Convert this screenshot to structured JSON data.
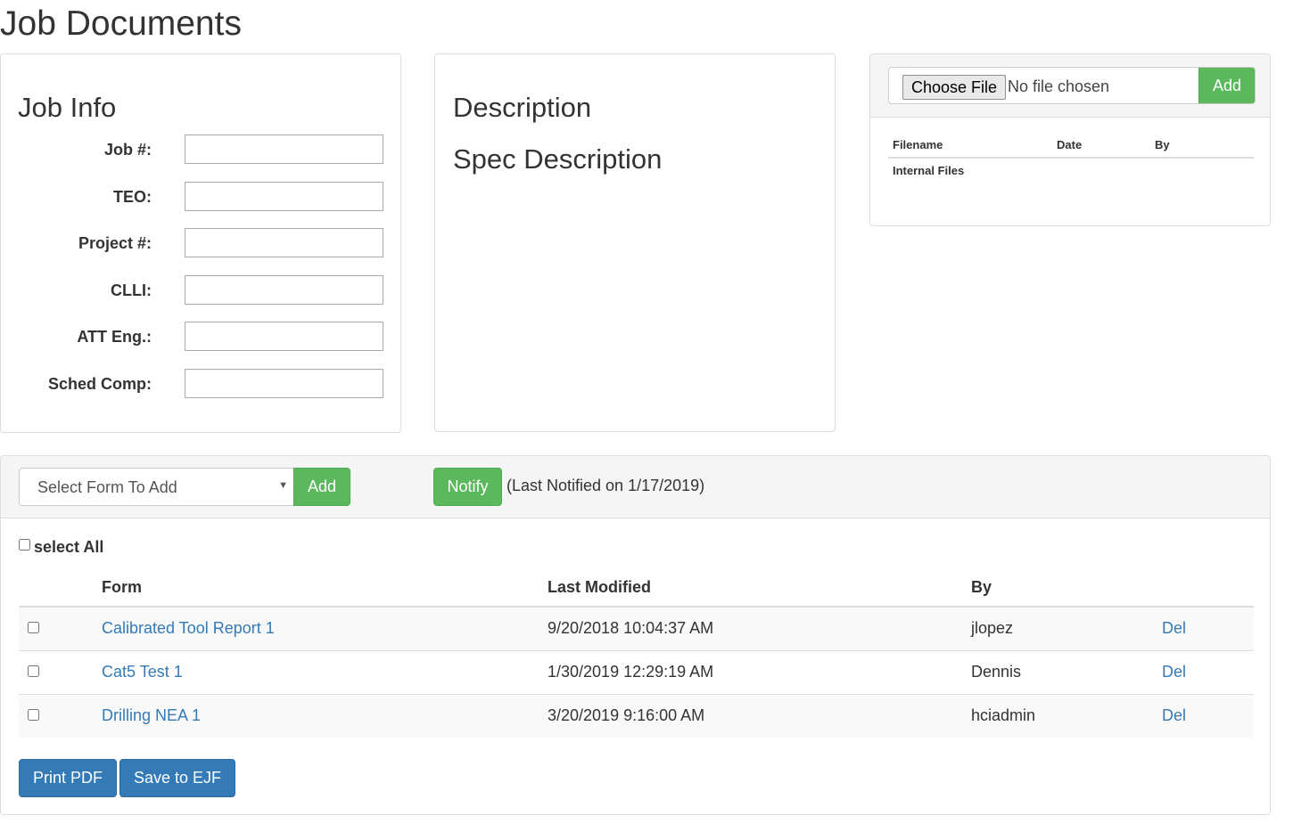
{
  "page": {
    "title": "Job Documents"
  },
  "job_info": {
    "heading": "Job Info",
    "fields": [
      {
        "label": "Job #:",
        "value": ""
      },
      {
        "label": "TEO:",
        "value": ""
      },
      {
        "label": "Project #:",
        "value": ""
      },
      {
        "label": "CLLI:",
        "value": ""
      },
      {
        "label": "ATT Eng.:",
        "value": ""
      },
      {
        "label": "Sched Comp:",
        "value": ""
      }
    ]
  },
  "description": {
    "heading": "Description",
    "spec_heading": "Spec Description"
  },
  "files": {
    "choose_file_label": "Choose File",
    "no_file_text": "No file chosen",
    "add_label": "Add",
    "columns": [
      "Filename",
      "Date",
      "By"
    ],
    "rows": [
      {
        "filename": "Internal Files",
        "date": "",
        "by": ""
      }
    ]
  },
  "forms": {
    "select_placeholder": "Select Form To Add",
    "add_label": "Add",
    "notify_label": "Notify",
    "last_notified": "(Last Notified on 1/17/2019)",
    "select_all_label": "select All",
    "columns": {
      "form": "Form",
      "last_modified": "Last Modified",
      "by": "By"
    },
    "rows": [
      {
        "form": "Calibrated Tool Report 1",
        "last_modified": "9/20/2018 10:04:37 AM",
        "by": "jlopez",
        "action": "Del"
      },
      {
        "form": "Cat5 Test 1",
        "last_modified": "1/30/2019 12:29:19 AM",
        "by": "Dennis",
        "action": "Del"
      },
      {
        "form": "Drilling NEA 1",
        "last_modified": "3/20/2019 9:16:00 AM",
        "by": "hciadmin",
        "action": "Del"
      }
    ],
    "print_pdf_label": "Print PDF",
    "save_ejf_label": "Save to EJF"
  },
  "colors": {
    "green": "#5cb85c",
    "blue": "#337ab7",
    "link": "#337ab7",
    "panel_heading": "#f5f5f5"
  }
}
